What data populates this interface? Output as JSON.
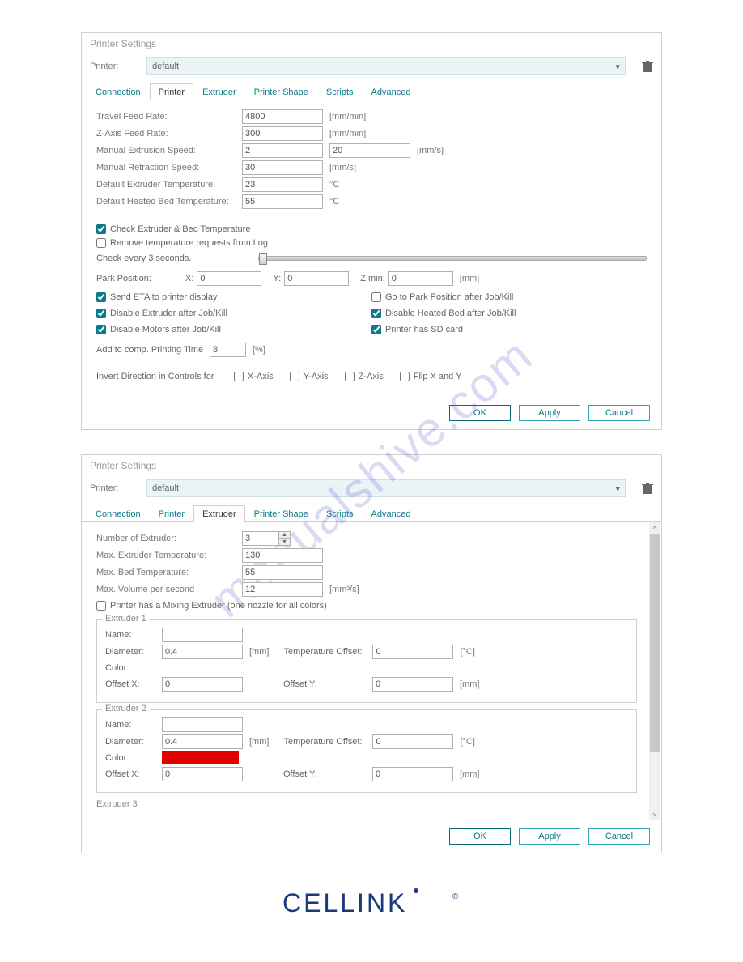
{
  "watermark": "manualshive.com",
  "dialog1": {
    "title": "Printer Settings",
    "printer_label": "Printer:",
    "printer_value": "default",
    "tabs": [
      "Connection",
      "Printer",
      "Extruder",
      "Printer Shape",
      "Scripts",
      "Advanced"
    ],
    "fields": {
      "travel_feed_label": "Travel Feed Rate:",
      "travel_feed_val": "4800",
      "travel_feed_unit": "[mm/min]",
      "z_feed_label": "Z-Axis Feed Rate:",
      "z_feed_val": "300",
      "z_feed_unit": "[mm/min]",
      "man_ext_label": "Manual Extrusion Speed:",
      "man_ext_val1": "2",
      "man_ext_val2": "20",
      "man_ext_unit": "[mm/s]",
      "man_ret_label": "Manual Retraction Speed:",
      "man_ret_val": "30",
      "man_ret_unit": "[mm/s]",
      "def_ext_label": "Default Extruder Temperature:",
      "def_ext_val": "23",
      "def_ext_unit": "°C",
      "def_bed_label": "Default Heated Bed Temperature:",
      "def_bed_val": "55",
      "def_bed_unit": "°C"
    },
    "chk_ext_bed": "Check Extruder & Bed Temperature",
    "chk_remove_log": "Remove temperature requests from Log",
    "check_every": "Check every 3 seconds.",
    "park_label": "Park Position:",
    "park_x_lbl": "X:",
    "park_x": "0",
    "park_y_lbl": "Y:",
    "park_y": "0",
    "park_z_lbl": "Z min:",
    "park_z": "0",
    "park_unit": "[mm]",
    "col_left": {
      "send_eta": "Send ETA to printer display",
      "dis_ext": "Disable Extruder after Job/Kill",
      "dis_mot": "Disable Motors after Job/Kill"
    },
    "col_right": {
      "go_park": "Go to Park Position after Job/Kill",
      "dis_bed": "Disable Heated Bed after Job/Kill",
      "sd_card": "Printer has SD card"
    },
    "add_comp_label": "Add to comp. Printing Time",
    "add_comp_val": "8",
    "add_comp_unit": "[%]",
    "invert_label": "Invert Direction in Controls for",
    "invert_x": "X-Axis",
    "invert_y": "Y-Axis",
    "invert_z": "Z-Axis",
    "flip_xy": "Flip X and Y",
    "buttons": {
      "ok": "OK",
      "apply": "Apply",
      "cancel": "Cancel"
    }
  },
  "dialog2": {
    "title": "Printer Settings",
    "printer_label": "Printer:",
    "printer_value": "default",
    "tabs": [
      "Connection",
      "Printer",
      "Extruder",
      "Printer Shape",
      "Scripts",
      "Advanced"
    ],
    "fields": {
      "num_ext_label": "Number of Extruder:",
      "num_ext_val": "3",
      "max_ext_label": "Max. Extruder Temperature:",
      "max_ext_val": "130",
      "max_bed_label": "Max. Bed Temperature:",
      "max_bed_val": "55",
      "max_vol_label": "Max. Volume per second",
      "max_vol_val": "12",
      "max_vol_unit": "[mm³/s]"
    },
    "chk_mixing": "Printer has a Mixing Extruder (one nozzle for all colors)",
    "ext1": {
      "legend": "Extruder 1",
      "name_lbl": "Name:",
      "name_val": "",
      "dia_lbl": "Diameter:",
      "dia_val": "0.4",
      "dia_unit": "[mm]",
      "temp_lbl": "Temperature Offset:",
      "temp_val": "0",
      "temp_unit": "[°C]",
      "color_lbl": "Color:",
      "color": "#0000d8",
      "offx_lbl": "Offset X:",
      "offx_val": "0",
      "offy_lbl": "Offset Y:",
      "offy_val": "0",
      "off_unit": "[mm]"
    },
    "ext2": {
      "legend": "Extruder 2",
      "name_lbl": "Name:",
      "name_val": "",
      "dia_lbl": "Diameter:",
      "dia_val": "0.4",
      "dia_unit": "[mm]",
      "temp_lbl": "Temperature Offset:",
      "temp_val": "0",
      "temp_unit": "[°C]",
      "color_lbl": "Color:",
      "color": "#e20000",
      "offx_lbl": "Offset X:",
      "offx_val": "0",
      "offy_lbl": "Offset Y:",
      "offy_val": "0",
      "off_unit": "[mm]"
    },
    "ext3_legend": "Extruder 3",
    "buttons": {
      "ok": "OK",
      "apply": "Apply",
      "cancel": "Cancel"
    }
  },
  "logo_text": "CELLINK"
}
